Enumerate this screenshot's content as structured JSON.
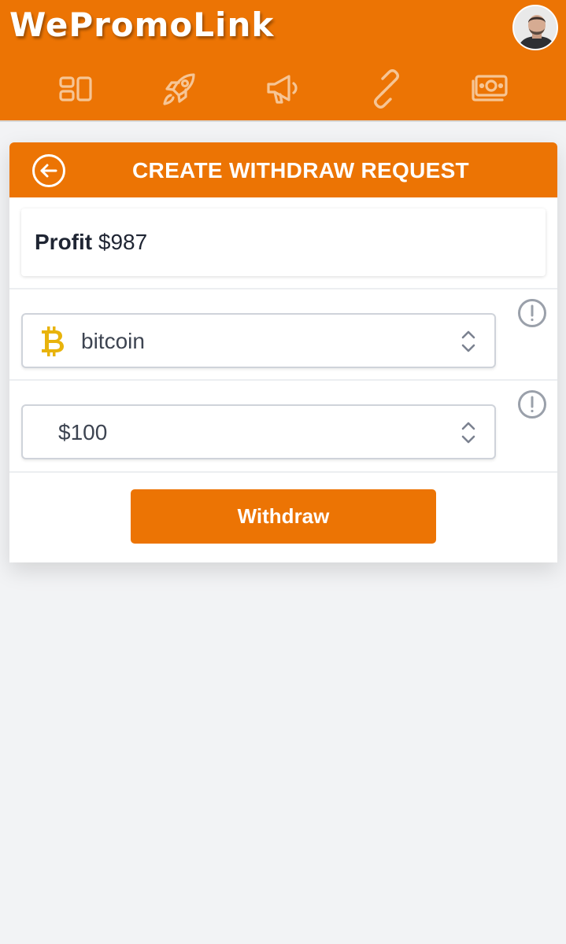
{
  "app": {
    "logo_text": "WePromoLink",
    "brand_color": "#ec7404"
  },
  "nav": {
    "items": [
      {
        "icon": "dashboard-icon"
      },
      {
        "icon": "rocket-icon"
      },
      {
        "icon": "megaphone-icon"
      },
      {
        "icon": "link-icon"
      },
      {
        "icon": "money-icon"
      }
    ]
  },
  "withdraw": {
    "title": "CREATE WITHDRAW REQUEST",
    "profit_label": "Profit",
    "profit_value": "$987",
    "method": {
      "icon": "bitcoin-icon",
      "icon_color": "#e8b30c",
      "value": "bitcoin"
    },
    "amount": {
      "value": "$100"
    },
    "submit_label": "Withdraw"
  }
}
